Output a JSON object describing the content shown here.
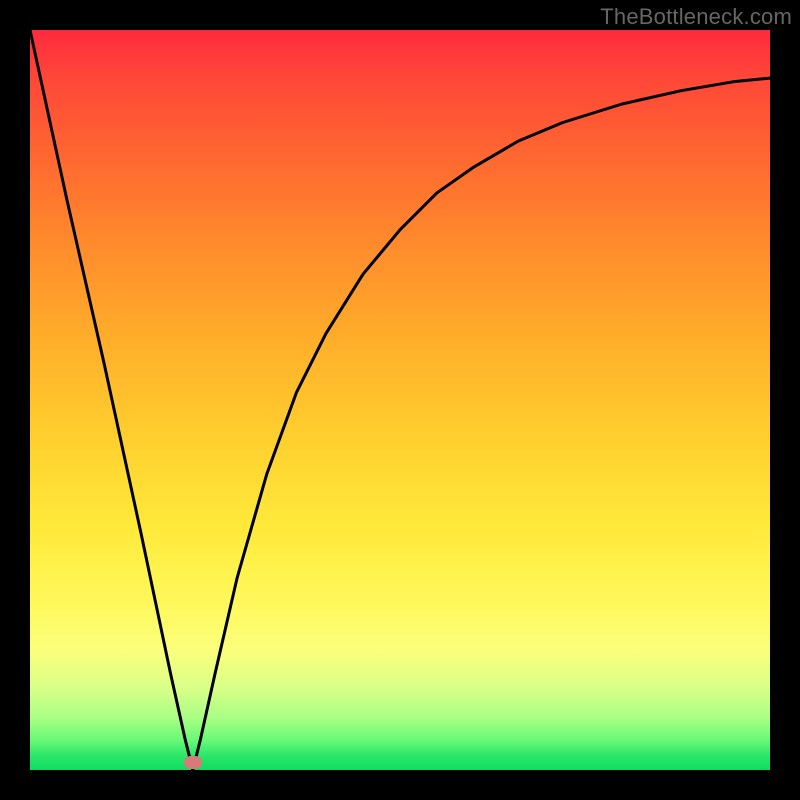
{
  "watermark": "TheBottleneck.com",
  "colors": {
    "background": "#000000",
    "gradient_top": "#ff2a3e",
    "gradient_bottom": "#0fdc62",
    "curve": "#000000",
    "marker": "#d87a7a",
    "watermark_text": "#666666"
  },
  "chart_data": {
    "type": "line",
    "title": "",
    "xlabel": "",
    "ylabel": "",
    "xlim": [
      0,
      100
    ],
    "ylim": [
      0,
      100
    ],
    "annotations": [
      {
        "kind": "marker",
        "x": 22,
        "y": 1
      }
    ],
    "series": [
      {
        "name": "curve",
        "x": [
          0,
          5,
          10,
          15,
          19,
          21,
          22,
          23,
          25,
          28,
          32,
          36,
          40,
          45,
          50,
          55,
          60,
          66,
          72,
          80,
          88,
          95,
          100
        ],
        "y": [
          100,
          77,
          55,
          32,
          13,
          4,
          0,
          4,
          13,
          26,
          40,
          51,
          59,
          67,
          73,
          78,
          81.5,
          85,
          87.5,
          90,
          91.8,
          93,
          93.5
        ]
      }
    ]
  }
}
